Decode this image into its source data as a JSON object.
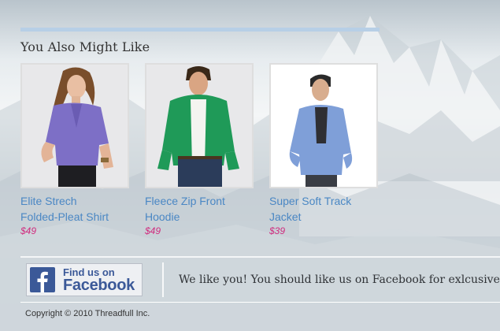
{
  "related": {
    "heading": "You Also Might Like",
    "products": [
      {
        "name_line1": "Elite Strech",
        "name_line2": "Folded-Pleat Shirt",
        "price": "$49"
      },
      {
        "name_line1": "Fleece Zip Front",
        "name_line2": "Hoodie",
        "price": "$49"
      },
      {
        "name_line1": "Super Soft Track",
        "name_line2": "Jacket",
        "price": "$39"
      }
    ]
  },
  "facebook": {
    "badge_line1": "Find us on",
    "badge_line2": "Facebook",
    "message": "We like you! You should like us on Facebook for exlcusive"
  },
  "footer": {
    "copyright": "Copyright © 2010 Threadfull Inc."
  },
  "colors": {
    "link": "#4a87c4",
    "price": "#d02b7e",
    "accent_rule": "#b7cfe6",
    "facebook_blue": "#3b5998"
  }
}
